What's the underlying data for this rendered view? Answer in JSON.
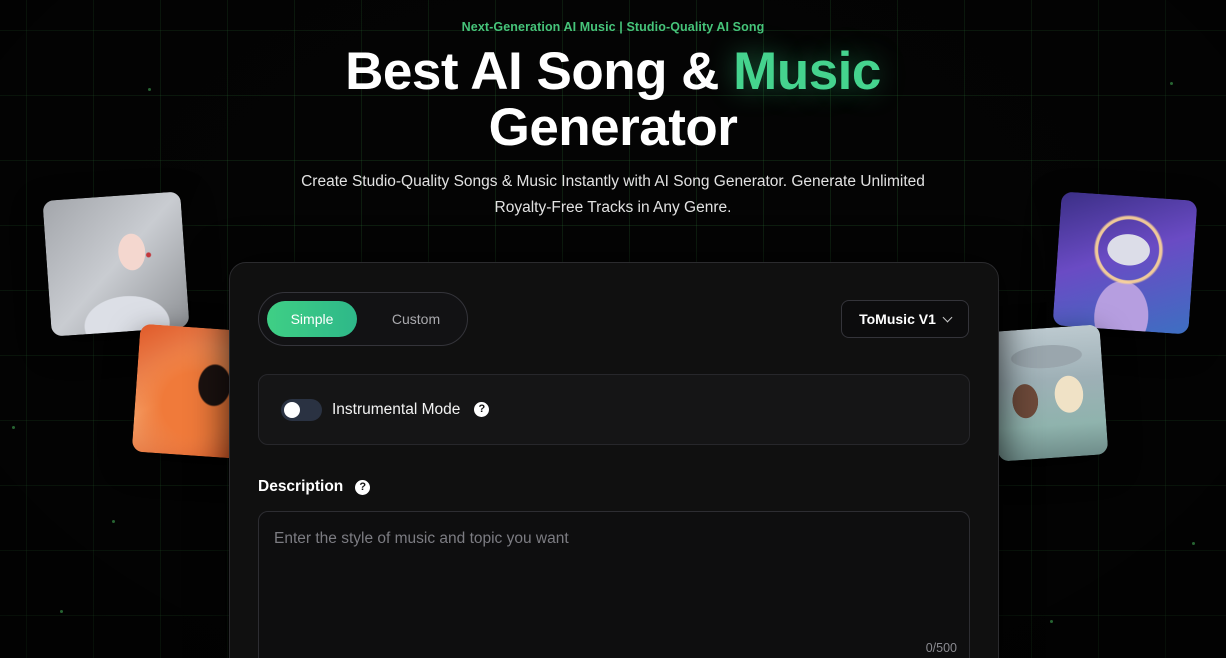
{
  "hero": {
    "eyebrow": "Next-Generation AI Music | Studio-Quality AI Song",
    "title_line1_plain": "Best AI Song & ",
    "title_line1_accent": "Music",
    "title_line2": "Generator",
    "subtitle_line1": "Create Studio-Quality Songs & Music Instantly with AI Song Generator. Generate Unlimited",
    "subtitle_line2": "Royalty-Free Tracks in Any Genre."
  },
  "form": {
    "modes": [
      "Simple",
      "Custom"
    ],
    "active_mode": "Simple",
    "model": "ToMusic V1",
    "instrumental_label": "Instrumental Mode",
    "instrumental_on": false,
    "description_label": "Description",
    "description_placeholder": "Enter the style of music and topic you want",
    "description_value": "",
    "char_counter": "0/500"
  },
  "colors": {
    "accent": "#45d38e",
    "eyebrow": "#46c47a",
    "panel_bg": "#101010",
    "page_bg": "#040404"
  },
  "icons": {
    "help": "question-circle-icon",
    "dropdown": "chevron-down-icon"
  }
}
